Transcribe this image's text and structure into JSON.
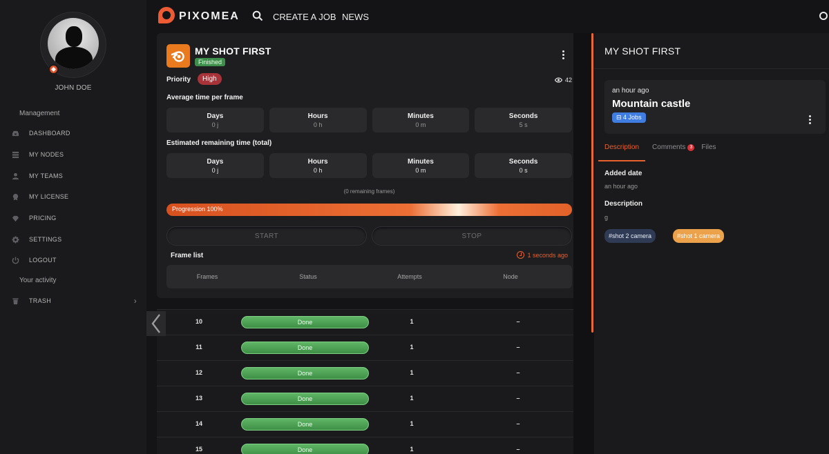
{
  "user": {
    "name": "JOHN DOE"
  },
  "sidebar": {
    "management_label": "Management",
    "items": [
      {
        "label": "DASHBOARD",
        "icon": "inbox-icon"
      },
      {
        "label": "MY NODES",
        "icon": "list-icon"
      },
      {
        "label": "MY TEAMS",
        "icon": "user-icon"
      },
      {
        "label": "MY LICENSE",
        "icon": "certificate-icon"
      },
      {
        "label": "PRICING",
        "icon": "gem-icon"
      },
      {
        "label": "SETTINGS",
        "icon": "gear-icon"
      },
      {
        "label": "LOGOUT",
        "icon": "power-icon"
      }
    ],
    "activity_label": "Your activity",
    "trash_label": "TRASH"
  },
  "nav": {
    "brand": "PIXOMEA",
    "create_job": "CREATE A JOB",
    "news": "NEWS"
  },
  "job": {
    "title": "MY SHOT FIRST",
    "status": "Finished",
    "priority_label": "Priority",
    "priority_value": "High",
    "views": "42",
    "avg_label": "Average time per frame",
    "avg": [
      {
        "k": "Days",
        "v": "0 j"
      },
      {
        "k": "Hours",
        "v": "0 h"
      },
      {
        "k": "Minutes",
        "v": "0 m"
      },
      {
        "k": "Seconds",
        "v": "5 s"
      }
    ],
    "est_label": "Estimated remaining time (total)",
    "est": [
      {
        "k": "Days",
        "v": "0 j"
      },
      {
        "k": "Hours",
        "v": "0 h"
      },
      {
        "k": "Minutes",
        "v": "0 m"
      },
      {
        "k": "Seconds",
        "v": "0 s"
      }
    ],
    "remaining_frames": "(0 remaining frames)",
    "progress_label": "Progression 100%",
    "progress_value": 1.0,
    "start_label": "START",
    "stop_label": "STOP",
    "frame_list_label": "Frame list",
    "updated_ago": "1 seconds ago",
    "table_headers": [
      "Frames",
      "Status",
      "Attempts",
      "Node"
    ],
    "frames": [
      {
        "frame": "10",
        "status": "Done",
        "attempts": "1",
        "node": "–"
      },
      {
        "frame": "11",
        "status": "Done",
        "attempts": "1",
        "node": "–"
      },
      {
        "frame": "12",
        "status": "Done",
        "attempts": "1",
        "node": "–"
      },
      {
        "frame": "13",
        "status": "Done",
        "attempts": "1",
        "node": "–"
      },
      {
        "frame": "14",
        "status": "Done",
        "attempts": "1",
        "node": "–"
      },
      {
        "frame": "15",
        "status": "Done",
        "attempts": "1",
        "node": "–"
      }
    ]
  },
  "panel": {
    "title": "MY SHOT FIRST",
    "project_time": "an hour ago",
    "project_name": "Mountain castle",
    "jobs_pill": "4 Jobs",
    "tabs": {
      "description": "Description",
      "comments": "Comments",
      "comments_count": "3",
      "files": "Files"
    },
    "added_label": "Added date",
    "added_value": "an hour ago",
    "description_label": "Description",
    "description_value": "g",
    "tags": [
      "#shot 2 camera",
      "#shot 1 camera"
    ]
  },
  "colors": {
    "accent": "#e8622e",
    "done": "#4fa356",
    "high": "#a8343a",
    "jobs": "#3f7ee0"
  }
}
